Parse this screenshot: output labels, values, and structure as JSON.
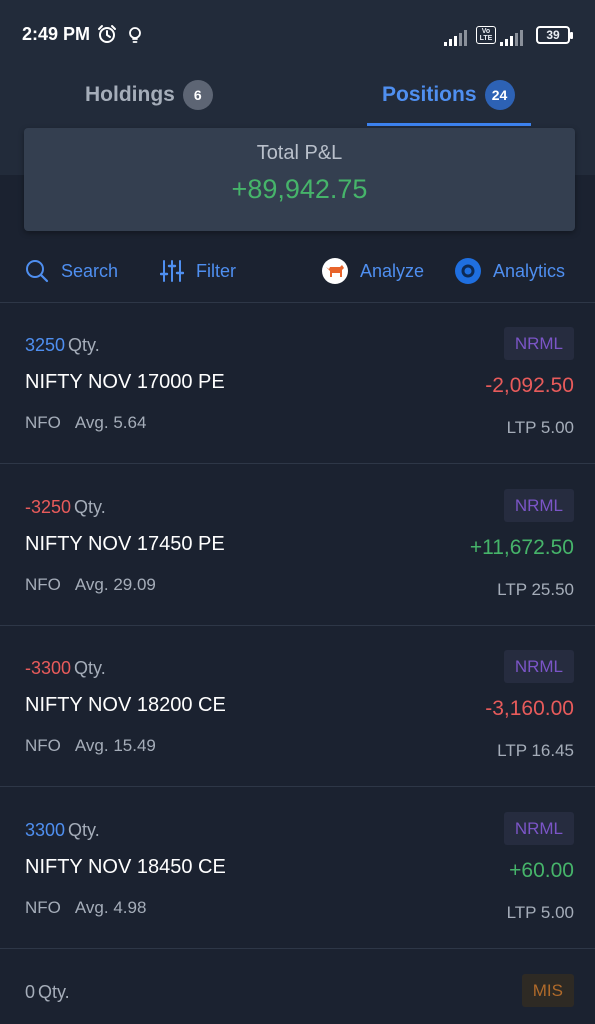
{
  "status_bar": {
    "time": "2:49 PM",
    "volte": "Vo LTE",
    "battery": "39"
  },
  "tabs": [
    {
      "label": "Holdings",
      "count": "6"
    },
    {
      "label": "Positions",
      "count": "24"
    }
  ],
  "summary": {
    "label": "Total P&L",
    "value": "+89,942.75"
  },
  "toolbar": {
    "search": "Search",
    "filter": "Filter",
    "analyze": "Analyze",
    "analytics": "Analytics"
  },
  "qty_suffix": "Qty.",
  "avg_prefix": "Avg.",
  "positions": [
    {
      "qty": "3250",
      "symbol": "NIFTY NOV 17000 PE",
      "exchange": "NFO",
      "avg": "5.64",
      "product": "NRML",
      "pnl": "-2,092.50",
      "ltp": "LTP 5.00"
    },
    {
      "qty": "-3250",
      "symbol": "NIFTY NOV 17450 PE",
      "exchange": "NFO",
      "avg": "29.09",
      "product": "NRML",
      "pnl": "+11,672.50",
      "ltp": "LTP 25.50"
    },
    {
      "qty": "-3300",
      "symbol": "NIFTY NOV 18200 CE",
      "exchange": "NFO",
      "avg": "15.49",
      "product": "NRML",
      "pnl": "-3,160.00",
      "ltp": "LTP 16.45"
    },
    {
      "qty": "3300",
      "symbol": "NIFTY NOV 18450 CE",
      "exchange": "NFO",
      "avg": "4.98",
      "product": "NRML",
      "pnl": "+60.00",
      "ltp": "LTP 5.00"
    },
    {
      "qty": "0",
      "product": "MIS"
    }
  ],
  "colors": {
    "accent": "#4f8ff0",
    "profit": "#46b46a",
    "loss": "#e85b5b",
    "nrml": "#7b55c7",
    "mis": "#b06a2a"
  }
}
